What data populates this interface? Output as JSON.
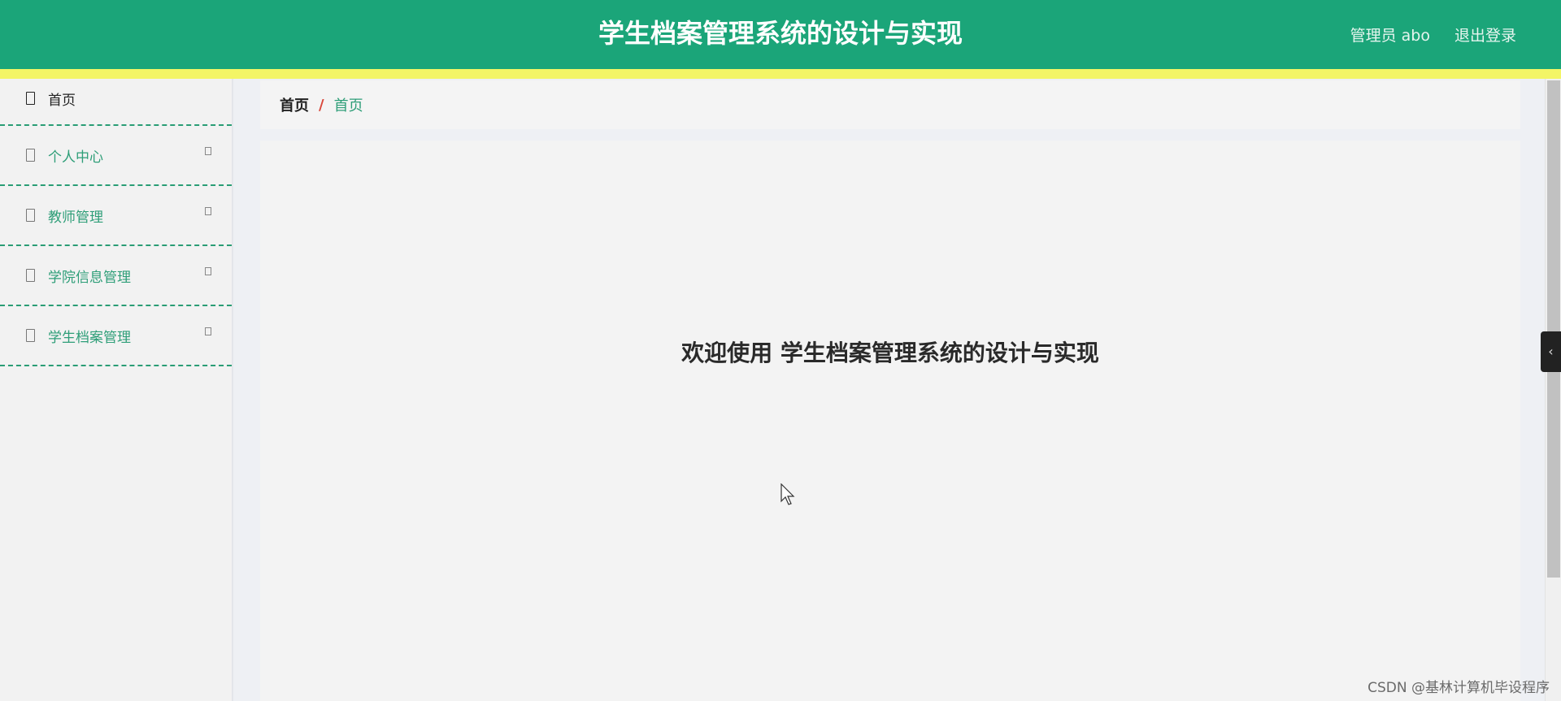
{
  "header": {
    "title": "学生档案管理系统的设计与实现",
    "user": "管理员 abo",
    "logout": "退出登录"
  },
  "sidebar": {
    "items": [
      {
        "label": "首页",
        "icon": "home-icon"
      },
      {
        "label": "个人中心",
        "icon": "user-icon"
      },
      {
        "label": "教师管理",
        "icon": "teacher-icon"
      },
      {
        "label": "学院信息管理",
        "icon": "college-icon"
      },
      {
        "label": "学生档案管理",
        "icon": "archive-icon"
      }
    ]
  },
  "breadcrumb": {
    "home": "首页",
    "separator": "/",
    "current": "首页"
  },
  "main": {
    "welcome": "欢迎使用 学生档案管理系统的设计与实现"
  },
  "watermark": "CSDN @基林计算机毕设程序",
  "colors": {
    "header": "#1ba579",
    "stripe": "#f3f566",
    "accent": "#2e9e78",
    "separator": "#d9473a"
  }
}
